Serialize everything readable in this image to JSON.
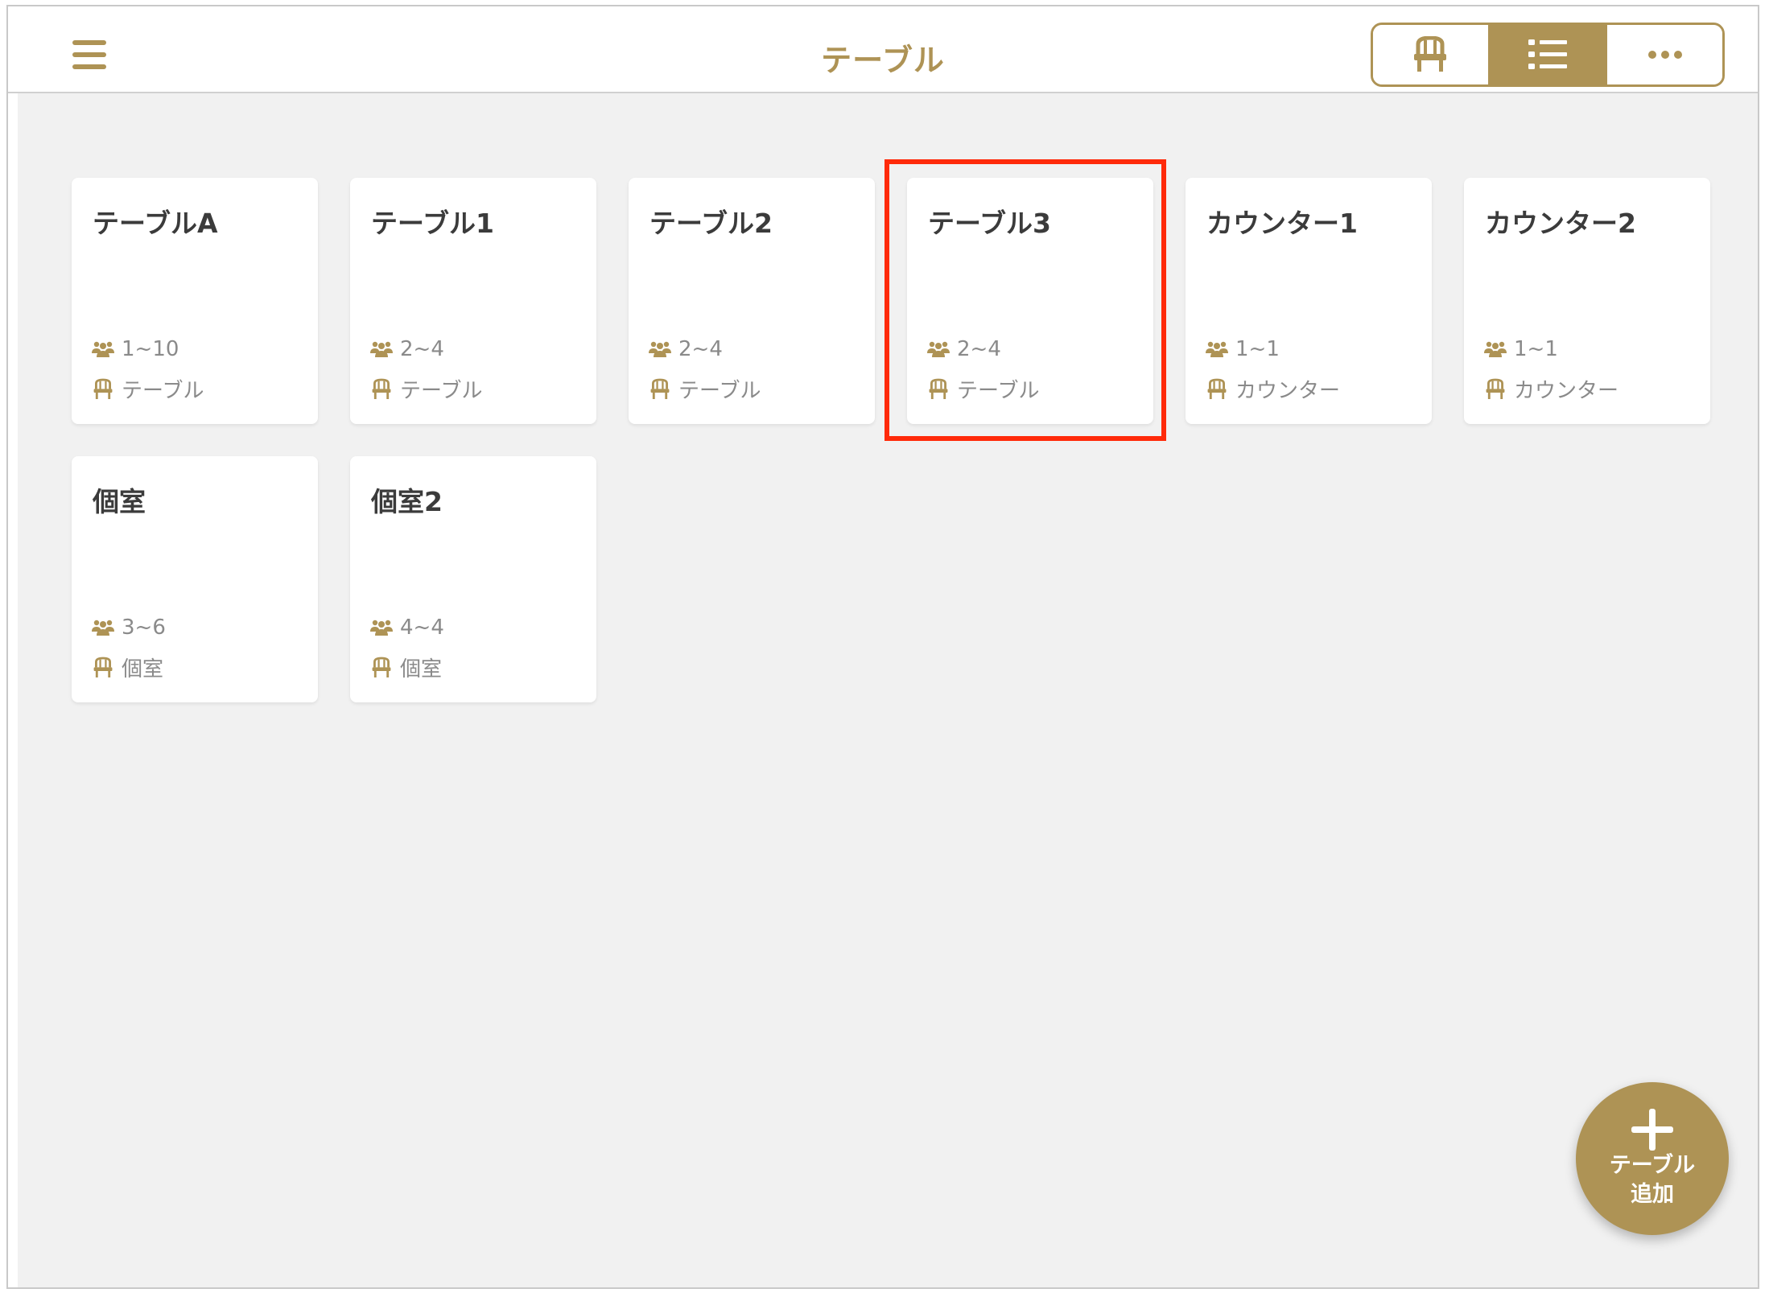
{
  "header": {
    "title": "テーブル",
    "menu_icon": "hamburger-menu-icon",
    "view_toggle": [
      {
        "name": "seat-view",
        "icon": "chair-icon",
        "active": false
      },
      {
        "name": "list-view",
        "icon": "list-icon",
        "active": true
      },
      {
        "name": "more",
        "icon": "more-dots-icon",
        "active": false
      }
    ]
  },
  "tables": [
    {
      "name": "テーブルA",
      "capacity": "1~10",
      "type": "テーブル"
    },
    {
      "name": "テーブル1",
      "capacity": "2~4",
      "type": "テーブル"
    },
    {
      "name": "テーブル2",
      "capacity": "2~4",
      "type": "テーブル"
    },
    {
      "name": "テーブル3",
      "capacity": "2~4",
      "type": "テーブル"
    },
    {
      "name": "カウンター1",
      "capacity": "1~1",
      "type": "カウンター"
    },
    {
      "name": "カウンター2",
      "capacity": "1~1",
      "type": "カウンター"
    },
    {
      "name": "個室",
      "capacity": "3~6",
      "type": "個室"
    },
    {
      "name": "個室2",
      "capacity": "4~4",
      "type": "個室"
    }
  ],
  "highlighted_table": "テーブル3",
  "fab": {
    "line1": "テーブル",
    "line2": "追加",
    "icon": "plus-icon"
  },
  "colors": {
    "accent": "#ae9355",
    "background": "#f1f1f1",
    "highlight": "#ff2a0a"
  }
}
